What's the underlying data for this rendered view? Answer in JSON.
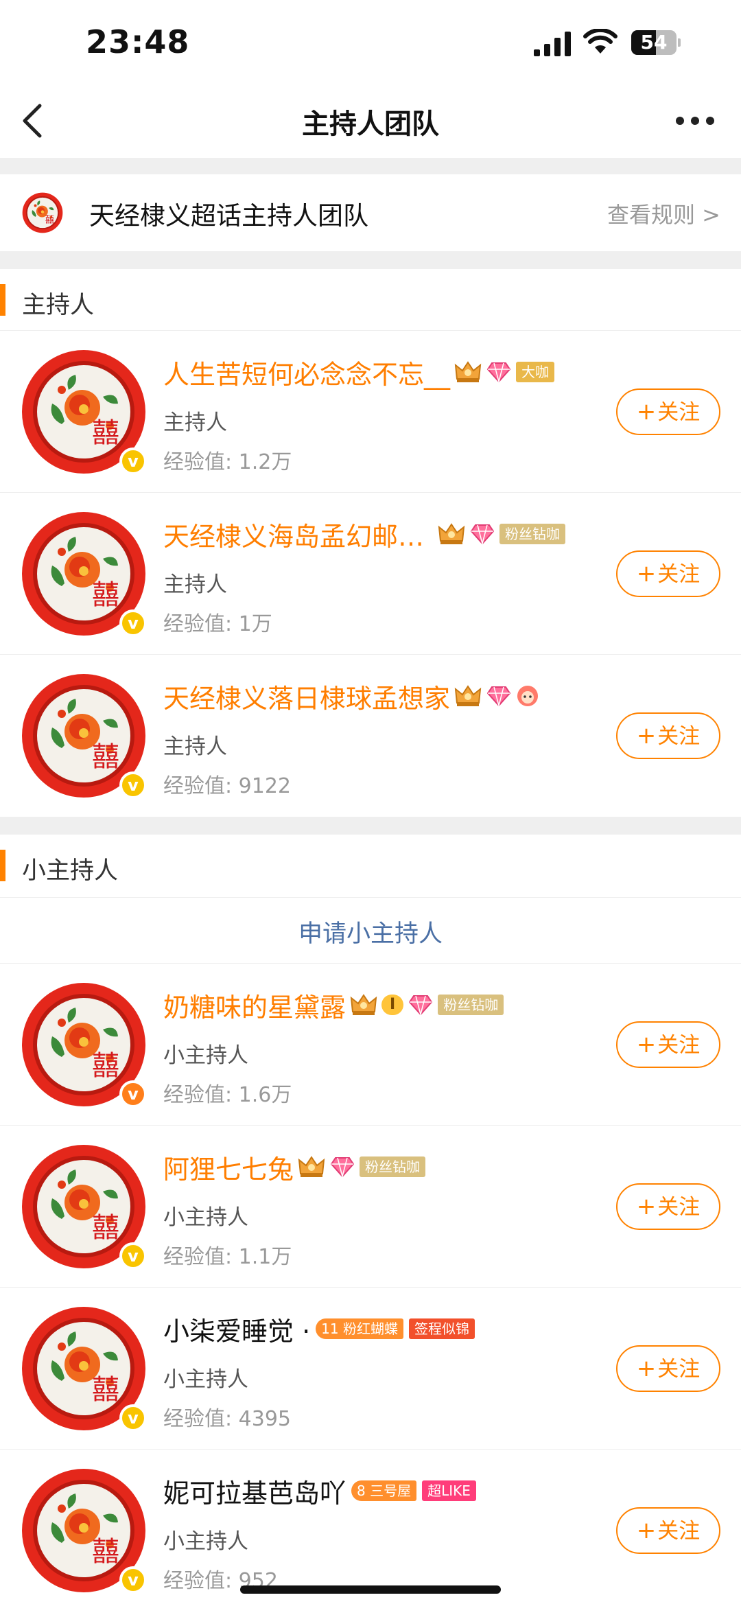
{
  "status_bar": {
    "time": "23:48",
    "battery": "54",
    "battery_level": 0.54
  },
  "nav": {
    "title": "主持人团队"
  },
  "team": {
    "name": "天经棣义超话主持人团队",
    "rules_link": "查看规则 >"
  },
  "hosts_section": {
    "title": "主持人",
    "members": [
      {
        "name": "人生苦短何必念念不忘__",
        "tags": [
          "大咖"
        ],
        "role": "主持人",
        "exp": "经验值: 1.2万",
        "follow": "关注"
      },
      {
        "name": "天经棣义海岛孟幻邮…",
        "tags": [
          "粉丝钻咖"
        ],
        "role": "主持人",
        "exp": "经验值: 1万",
        "follow": "关注"
      },
      {
        "name": "天经棣义落日棣球孟想家",
        "tags": [],
        "role": "主持人",
        "exp": "经验值: 9122",
        "follow": "关注"
      }
    ]
  },
  "sub_hosts_section": {
    "title": "小主持人",
    "apply_label": "申请小主持人",
    "members": [
      {
        "name": "奶糖味的星黛露",
        "level": "I",
        "tags": [
          "粉丝钻咖"
        ],
        "role": "小主持人",
        "exp": "经验值: 1.6万",
        "follow": "关注"
      },
      {
        "name": "阿狸七七兔",
        "tags": [
          "粉丝钻咖"
        ],
        "role": "小主持人",
        "exp": "经验值: 1.1万",
        "follow": "关注"
      },
      {
        "name": "小柒爱睡觉 ·",
        "badge_level": "11",
        "tags": [
          "粉红蝴蝶",
          "签程似锦"
        ],
        "role": "小主持人",
        "exp": "经验值: 4395",
        "follow": "关注"
      },
      {
        "name": "妮可拉基芭岛吖",
        "badge_level": "8",
        "tags": [
          "三号屋",
          "超LIKE"
        ],
        "role": "小主持人",
        "exp": "经验值: 952",
        "follow": "关注"
      }
    ]
  },
  "colors": {
    "accent": "#ff8200",
    "name_orange": "#ff7e00",
    "link_blue": "#4a6fa5",
    "verified_gold": "#f9c400",
    "verified_orange": "#ff7e1a"
  },
  "icons": {
    "back": "chevron-left-icon",
    "more": "more-dots-icon",
    "crown": "crown-icon",
    "gem": "gem-icon",
    "verified": "verified-v-icon"
  }
}
